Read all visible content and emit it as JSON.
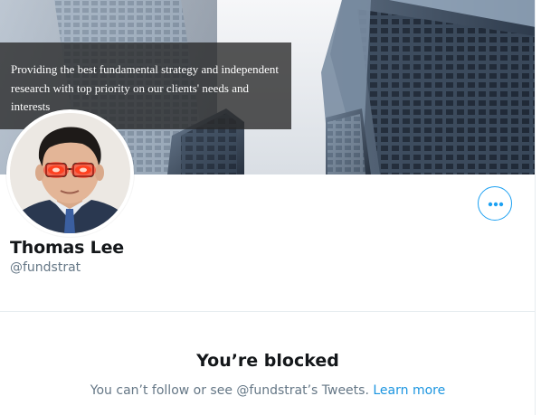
{
  "profile": {
    "banner_caption": "Providing the best fundamental strategy and independent research with top priority on our clients' needs and interests",
    "display_name": "Thomas Lee",
    "handle": "@fundstrat",
    "avatar_icon": "profile-photo-laser-eyes",
    "more_button_icon": "more-dots-icon"
  },
  "blocked": {
    "title": "You’re blocked",
    "message": "You can’t follow or see @fundstrat’s Tweets.",
    "link_label": "Learn more"
  },
  "colors": {
    "accent": "#1da1f2",
    "link": "#1b95e0",
    "primary_text": "#14171a",
    "secondary_text": "#657786",
    "divider": "#e6ecf0"
  }
}
